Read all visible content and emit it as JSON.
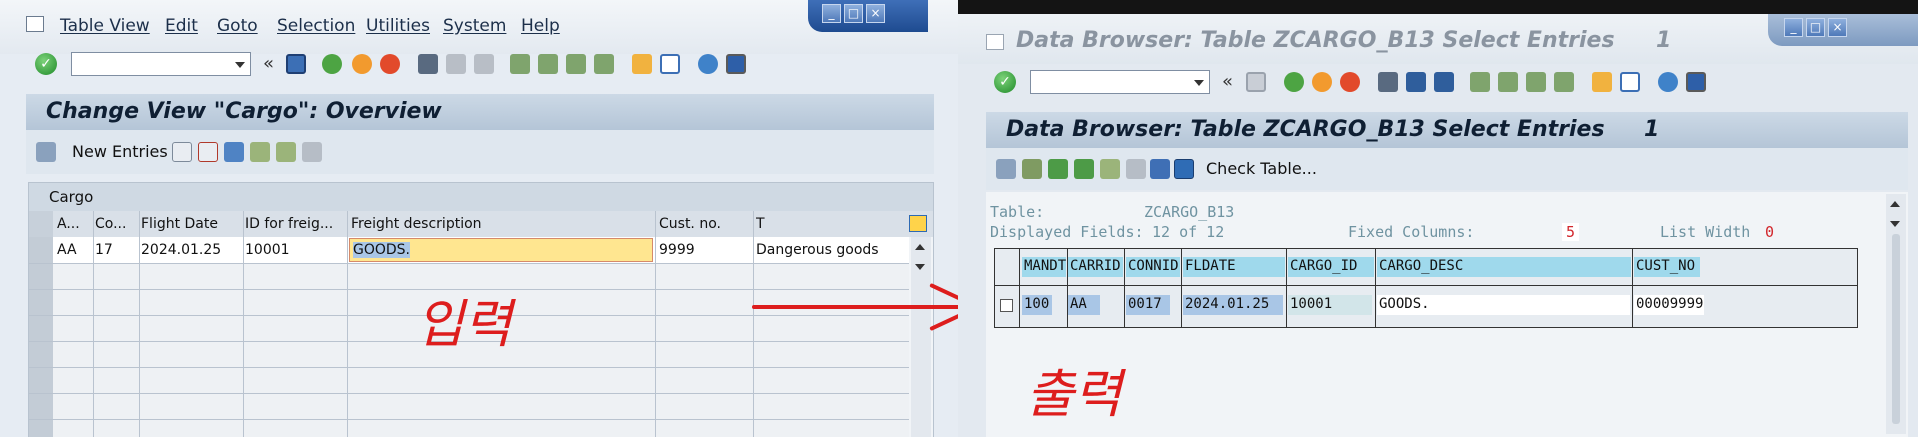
{
  "left": {
    "menu": [
      "Table View",
      "Edit",
      "Goto",
      "Selection",
      "Utilities",
      "System",
      "Help"
    ],
    "panel_title": "Change View \"Cargo\": Overview",
    "new_entries_label": "New Entries",
    "table_title": "Cargo",
    "columns": [
      "A...",
      "Co...",
      "Flight Date",
      "ID for freig...",
      "Freight description",
      "Cust. no.",
      "T"
    ],
    "row": [
      "AA",
      "17",
      "2024.01.25",
      "10001",
      "GOODS.",
      "9999",
      "Dangerous goods"
    ],
    "annotation": "입력"
  },
  "right": {
    "title": "Data Browser: Table ZCARGO_B13 Select Entries",
    "title_count": "1",
    "panel_title": "Data Browser: Table ZCARGO_B13 Select Entries",
    "panel_count": "1",
    "check_table_label": "Check Table...",
    "table_label": "Table:",
    "table_value": "ZCARGO_B13",
    "displayed_fields_label": "Displayed Fields:",
    "displayed_fields_value": "12 of  12",
    "fixed_columns_label": "Fixed Columns:",
    "fixed_columns_value": "5",
    "list_width_label": "List Width",
    "list_width_value": "0",
    "columns": [
      "MANDT",
      "CARRID",
      "CONNID",
      "FLDATE",
      "CARGO_ID",
      "CARGO_DESC",
      "CUST_NO"
    ],
    "row": [
      "100",
      "AA",
      "0017",
      "2024.01.25",
      "10001",
      "GOODS.",
      "00009999"
    ],
    "annotation": "출력"
  },
  "colors": {
    "accent": "#1e4b90",
    "highlight": "#9fd9ec",
    "selected_cell": "#ffe690",
    "annotation": "#dd1d1d"
  }
}
